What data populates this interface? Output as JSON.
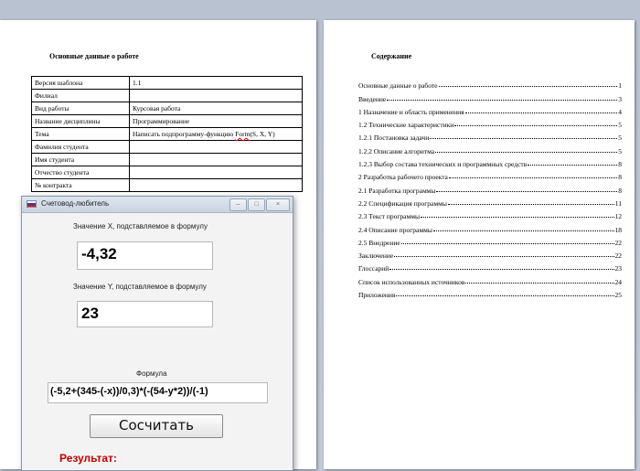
{
  "left_page": {
    "title": "Основные данные о работе",
    "rows": [
      {
        "label": "Версия шаблона",
        "value": "1.1"
      },
      {
        "label": "Филиал",
        "value": ""
      },
      {
        "label": "Вид работы",
        "value": "Курсовая работа"
      },
      {
        "label": "Название дисциплины",
        "value": "Программирование"
      },
      {
        "label": "Тема",
        "value": "Написать подпрограмму-функцию  Form(S, X, Y)"
      },
      {
        "label": "Фамилия студента",
        "value": ""
      },
      {
        "label": "Имя студента",
        "value": ""
      },
      {
        "label": "Отчество студента",
        "value": ""
      },
      {
        "label": "№ контракта",
        "value": ""
      }
    ]
  },
  "right_page": {
    "title": "Содержание",
    "toc": [
      {
        "text": "Основные данные о работе",
        "page": "1"
      },
      {
        "text": "Введение",
        "page": "3"
      },
      {
        "text": "1 Назначение и область применения",
        "page": "4"
      },
      {
        "text": "1.2 Технические характеристики",
        "page": "5"
      },
      {
        "text": "1.2.1 Постановка задачи",
        "page": "5"
      },
      {
        "text": "1.2.2  Описание алгоритма",
        "page": "5"
      },
      {
        "text": "1.2.3  Выбор состава технических и программных средств",
        "page": "8"
      },
      {
        "text": "2 Разработка рабочего проекта",
        "page": "8"
      },
      {
        "text": "2.1 Разработка программы",
        "page": "8"
      },
      {
        "text": "2.2 Спецификация программы",
        "page": "11"
      },
      {
        "text": "2.3 Текст программы",
        "page": "12"
      },
      {
        "text": "2.4 Описание программы",
        "page": "18"
      },
      {
        "text": "2.5 Внедрение",
        "page": "22"
      },
      {
        "text": "Заключение",
        "page": "22"
      },
      {
        "text": "Глоссарий",
        "page": "23"
      },
      {
        "text": "Список использованных источников",
        "page": "24"
      },
      {
        "text": "Приложения",
        "page": "25"
      }
    ]
  },
  "window": {
    "title": "Счетовод-любитель",
    "x_label": "Значение X, подставляемое в формулу",
    "x_value": "-4,32",
    "y_label": "Значение Y, подставляемое в формулу",
    "y_value": "23",
    "formula_label": "Формула",
    "formula_value": "(-5,2+(345-(-x))/0,3)*(-(54-y*2))/(-1)",
    "calc_button": "Сосчитать",
    "result_label": "Результат:",
    "btn_min": "–",
    "btn_max": "□",
    "btn_close": "×"
  },
  "colors": {
    "result": "#c00000",
    "background": "#c0c8d6"
  }
}
